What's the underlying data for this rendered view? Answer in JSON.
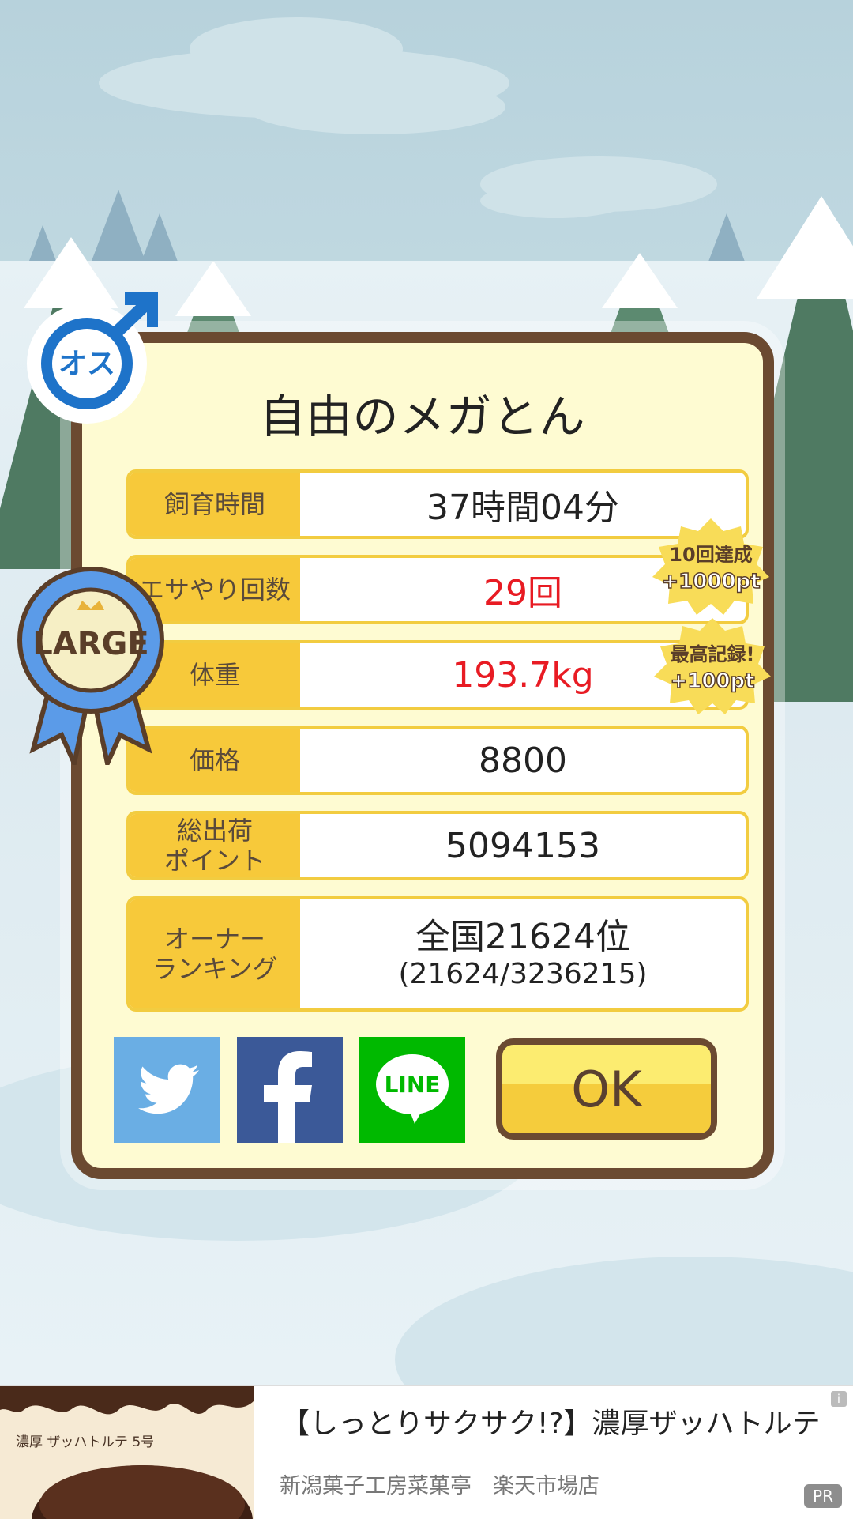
{
  "dialog": {
    "title": "自由のメガとん",
    "rows": [
      {
        "label": "飼育時間",
        "value": "37時間04分"
      },
      {
        "label": "エサやり回数",
        "value": "29回"
      },
      {
        "label": "体重",
        "value": "193.7kg"
      },
      {
        "label": "価格",
        "value": "8800"
      },
      {
        "label": "総出荷\nポイント",
        "value": "5094153"
      },
      {
        "label": "オーナー\nランキング",
        "value_main": "全国21624位",
        "value_sub": "(21624/3236215)"
      }
    ],
    "ok_label": "OK",
    "share": {
      "twitter": "twitter-icon",
      "facebook": "facebook-icon",
      "line_label": "LINE"
    }
  },
  "badges": {
    "gender_label": "オス",
    "size_label": "LARGE",
    "bonus1_line1": "10回達成",
    "bonus1_line2": "+1000pt",
    "bonus2_line1": "最高記録!",
    "bonus2_line2": "+100pt"
  },
  "ad": {
    "image_label": "濃厚 ザッハトルテ 5号",
    "title": "【しっとりサクサク!?】濃厚ザッハトルテ",
    "source": "新潟菓子工房菜菓亭　楽天市場店",
    "pr_label": "PR",
    "info_label": "i"
  },
  "colors": {
    "frame": "#6b4a31",
    "panel": "#fefbd2",
    "label_bg": "#f7c93a",
    "highlight_red": "#e81b23",
    "twitter": "#6aaee4",
    "facebook": "#3b5998",
    "line": "#00b900"
  }
}
